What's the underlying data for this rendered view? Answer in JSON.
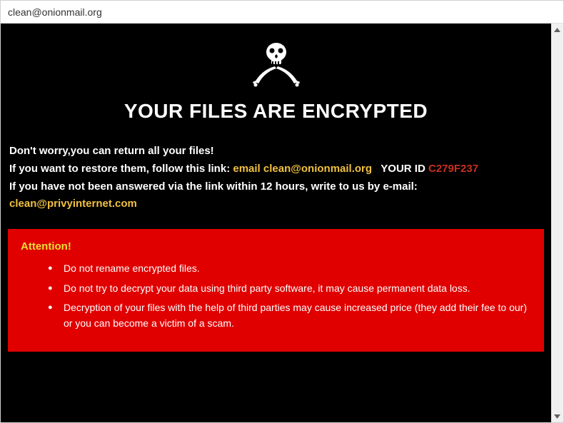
{
  "window": {
    "title": "clean@onionmail.org"
  },
  "content": {
    "heading": "YOUR FILES ARE ENCRYPTED",
    "line1": "Don't worry,you can return all your files!",
    "line2_prefix": "If you want to restore them, follow this link:",
    "line2_email_label": "email",
    "line2_email": "clean@onionmail.org",
    "line2_yourid_label": "YOUR ID",
    "line2_id": "C279F237",
    "line3": "If you have not been answered via the link within 12 hours, write to us by e-mail:",
    "line3_email": "clean@privyinternet.com"
  },
  "attention": {
    "heading": "Attention!",
    "items": [
      "Do not rename encrypted files.",
      "Do not try to decrypt your data using third party software, it may cause permanent data loss.",
      "Decryption of your files with the help of third parties may cause increased price (they add their fee to our) or you can become a victim of a scam."
    ]
  }
}
